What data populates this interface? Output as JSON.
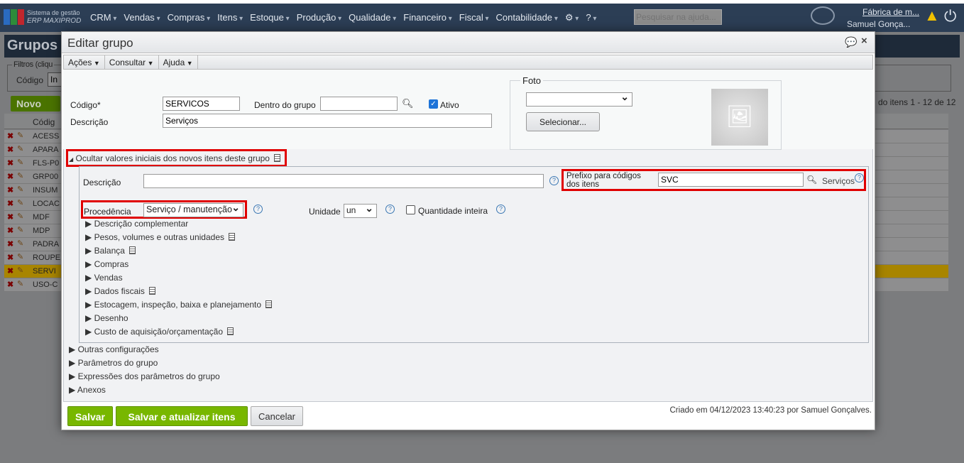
{
  "nav": {
    "system_line1": "Sistema de gestão",
    "system_line2": "ERP MAXIPROD",
    "menu": [
      "CRM",
      "Vendas",
      "Compras",
      "Itens",
      "Estoque",
      "Produção",
      "Qualidade",
      "Financeiro",
      "Fiscal",
      "Contabilidade"
    ],
    "search_placeholder": "Pesquisar na ajuda...",
    "company": "Fábrica de m...",
    "user": "Samuel Gonça..."
  },
  "background": {
    "page_title": "Grupos",
    "filters_legend": "Filtros (cliqu",
    "filter_label": "Código",
    "filter_value": "In",
    "new_button": "Novo",
    "column_code": "Códig",
    "paging": "do itens 1 - 12 de 12",
    "rows": [
      "ACESS",
      "APARA",
      "FLS-P0",
      "GRP00",
      "INSUM",
      "LOCAC",
      "MDF",
      "MDP",
      "PADRA",
      "ROUPE",
      "SERVI",
      "USO-C"
    ],
    "highlight_color": "#e6a800"
  },
  "modal": {
    "title": "Editar grupo",
    "menu": [
      "Ações",
      "Consultar",
      "Ajuda"
    ],
    "codigo_label": "Código*",
    "codigo_value": "SERVICOS",
    "dentro_label": "Dentro do grupo",
    "dentro_value": "",
    "ativo_label": "Ativo",
    "ativo_checked": true,
    "descricao_label": "Descrição",
    "descricao_value": "Serviços",
    "foto_legend": "Foto",
    "foto_select": "",
    "selecionar_button": "Selecionar...",
    "toggle_section": "Ocultar valores iniciais dos novos itens deste grupo",
    "inner": {
      "descricao_label": "Descrição",
      "descricao_value": "",
      "prefixo_label_1": "Prefixo para códigos",
      "prefixo_label_2": "dos itens",
      "prefixo_value": "SVC",
      "prefixo_hint": "Serviços",
      "procedencia_label": "Procedência",
      "procedencia_value": "Serviço / manutenção",
      "unidade_label": "Unidade",
      "unidade_value": "un",
      "quantidade_label": "Quantidade inteira",
      "quantidade_checked": false,
      "sections": [
        "Descrição complementar",
        "Pesos, volumes e outras unidades",
        "Balança",
        "Compras",
        "Vendas",
        "Dados fiscais",
        "Estocagem, inspeção, baixa e planejamento",
        "Desenho",
        "Custo de aquisição/orçamentação"
      ]
    },
    "outer_sections": [
      "Outras configurações",
      "Parâmetros do grupo",
      "Expressões dos parâmetros do grupo",
      "Anexos"
    ],
    "save": "Salvar",
    "save_update": "Salvar e atualizar itens",
    "cancel": "Cancelar",
    "created": "Criado em 04/12/2023 13:40:23 por Samuel Gonçalves."
  },
  "colors": {
    "nav": "#2c3e55",
    "green": "#78b700",
    "highlight": "#e00000"
  }
}
